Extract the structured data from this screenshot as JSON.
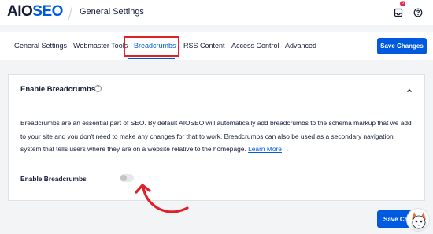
{
  "header": {
    "logo_part1": "AIO",
    "logo_part2": "SEO",
    "title": "General Settings",
    "notification_count": "0"
  },
  "tabs": [
    {
      "label": "General Settings"
    },
    {
      "label": "Webmaster Tools"
    },
    {
      "label": "Breadcrumbs",
      "active": true
    },
    {
      "label": "RSS Content"
    },
    {
      "label": "Access Control"
    },
    {
      "label": "Advanced"
    }
  ],
  "save_button_label": "Save Changes",
  "bottom_save_label": "Save Cha",
  "card": {
    "title": "Enable Breadcrumbs",
    "description": "Breadcrumbs are an essential part of SEO. By default AIOSEO will automatically add breadcrumbs to the schema markup that we add to your site and you don't need to make any changes for that to work. Breadcrumbs can also be used as a secondary navigation system that tells users where they are on a website relative to the homepage.",
    "learn_more": "Learn More",
    "learn_more_arrow": "→",
    "setting_label": "Enable Breadcrumbs",
    "toggle_on": false
  },
  "colors": {
    "accent": "#005ae0",
    "highlight": "#e0202a",
    "text": "#141b38"
  }
}
